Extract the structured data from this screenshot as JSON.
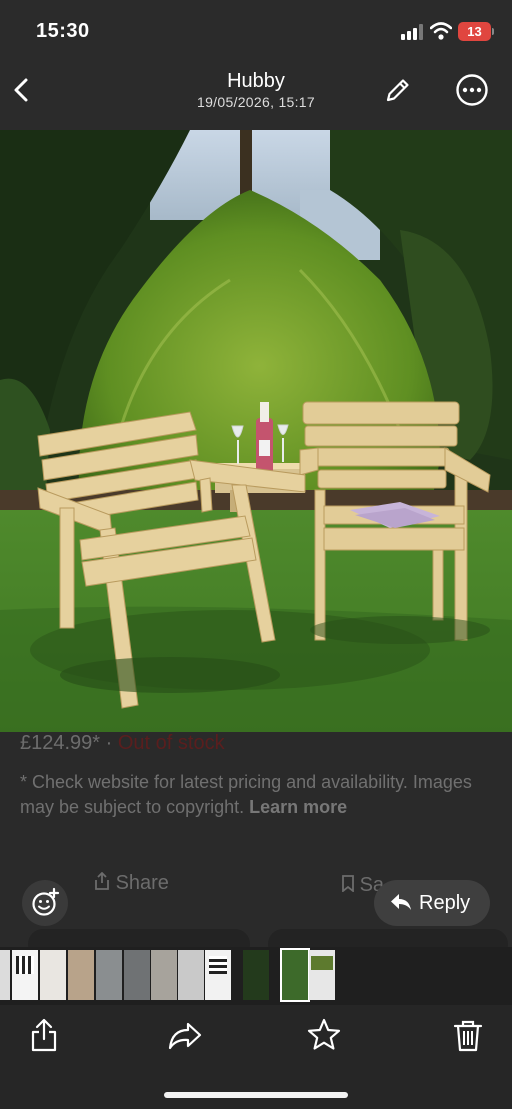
{
  "status_bar": {
    "time": "15:30",
    "battery": "13"
  },
  "header": {
    "title": "Hubby",
    "subtitle": "19/05/2026, 15:17"
  },
  "listing": {
    "price": "£124.99*",
    "separator": "·",
    "availability": "Out of stock",
    "disclaimer": "* Check website for latest pricing and availability. Images may be subject to copyright.",
    "learn_more": "Learn more"
  },
  "actions": {
    "share_label": "Share",
    "save_label": "Sa",
    "reply_label": "Reply"
  },
  "colors": {
    "background": "#2b2b2b",
    "battery": "#e0463f",
    "availability": "#5a1e1e"
  },
  "icons": [
    "back-icon",
    "pencil-icon",
    "more-icon",
    "emoji-icon",
    "reply-icon",
    "share-icon",
    "forward-icon",
    "star-icon",
    "trash-icon"
  ]
}
